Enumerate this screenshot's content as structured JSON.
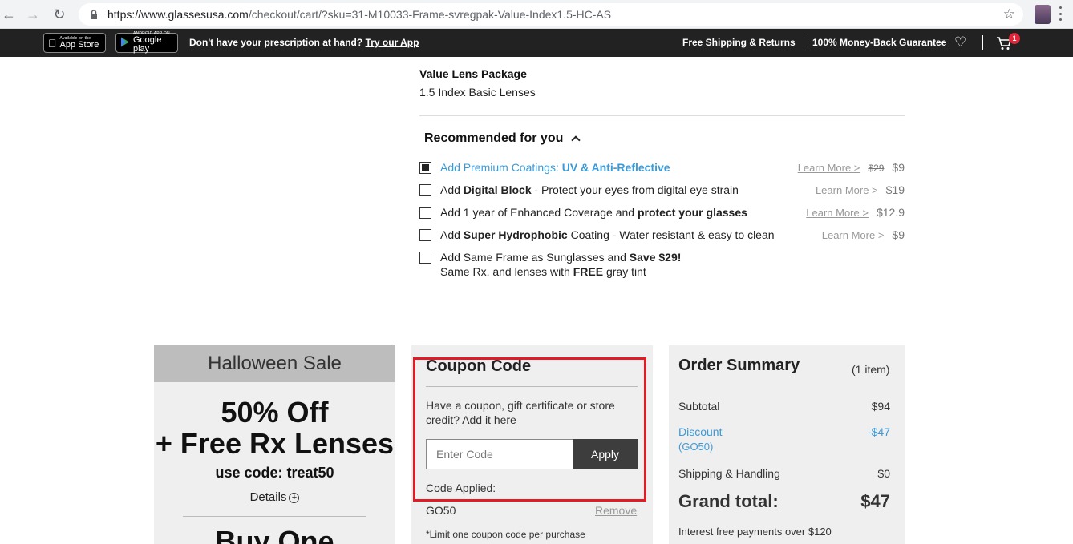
{
  "browser": {
    "url_host": "https://www.glassesusa.com",
    "url_path": "/checkout/cart/?sku=31-M10033-Frame-svregpak-Value-Index1.5-HC-AS"
  },
  "topbar": {
    "app_store_small": "Available on the",
    "app_store_big": "App Store",
    "google_small": "ANDROID APP ON",
    "google_big": "Google play",
    "prompt_text": "Don't have your prescription at hand?",
    "prompt_link": "Try our App",
    "shipping": "Free Shipping & Returns",
    "guarantee": "100% Money-Back Guarantee",
    "cart_count": "1"
  },
  "lens": {
    "title": "Value Lens Package",
    "desc": "1.5 Index Basic Lenses"
  },
  "recommended": {
    "title": "Recommended for you",
    "options": [
      {
        "checked": true,
        "plain": "Add Premium Coatings: ",
        "bold": "UV & Anti-Reflective",
        "learn": "Learn More >",
        "old_price": "$29",
        "price": "$9"
      },
      {
        "checked": false,
        "plain1": "Add ",
        "bold": "Digital Block",
        "plain2": " - Protect your eyes from digital eye strain",
        "learn": "Learn More >",
        "price": "$19"
      },
      {
        "checked": false,
        "plain1": "Add 1 year of Enhanced Coverage and ",
        "bold": "protect your glasses",
        "learn": "Learn More >",
        "price": "$12.9"
      },
      {
        "checked": false,
        "plain1": "Add ",
        "bold": "Super Hydrophobic",
        "plain2": " Coating - Water resistant & easy to clean",
        "learn": "Learn More >",
        "price": "$9"
      },
      {
        "checked": false,
        "plain1": "Add Same Frame as Sunglasses and ",
        "bold": "Save $29!",
        "line2_plain1": "Same Rx. and lenses with ",
        "line2_bold": "FREE",
        "line2_plain2": " gray tint"
      }
    ]
  },
  "halloween": {
    "header": "Halloween Sale",
    "line1": "50% Off",
    "line2": "+ Free Rx Lenses",
    "code_line": "use code: treat50",
    "details": "Details",
    "buy": "Buy One"
  },
  "coupon": {
    "title": "Coupon Code",
    "desc": "Have a coupon, gift certificate or store credit? Add it here",
    "placeholder": "Enter Code",
    "apply": "Apply",
    "applied_label": "Code Applied:",
    "applied_code": "GO50",
    "remove": "Remove",
    "limit": "*Limit one coupon code per purchase",
    "highlight_color": "#e21b24"
  },
  "summary": {
    "title": "Order Summary",
    "count": "(1 item)",
    "subtotal_label": "Subtotal",
    "subtotal": "$94",
    "discount_label": "Discount",
    "discount_code": "(GO50)",
    "discount": "-$47",
    "shipping_label": "Shipping & Handling",
    "shipping": "$0",
    "grand_label": "Grand total:",
    "grand": "$47",
    "interest": "Interest free payments over $120"
  },
  "colors": {
    "accent_blue": "#3a9bd9",
    "dark_bar": "#222222",
    "apply_button": "#3d3d3d"
  }
}
